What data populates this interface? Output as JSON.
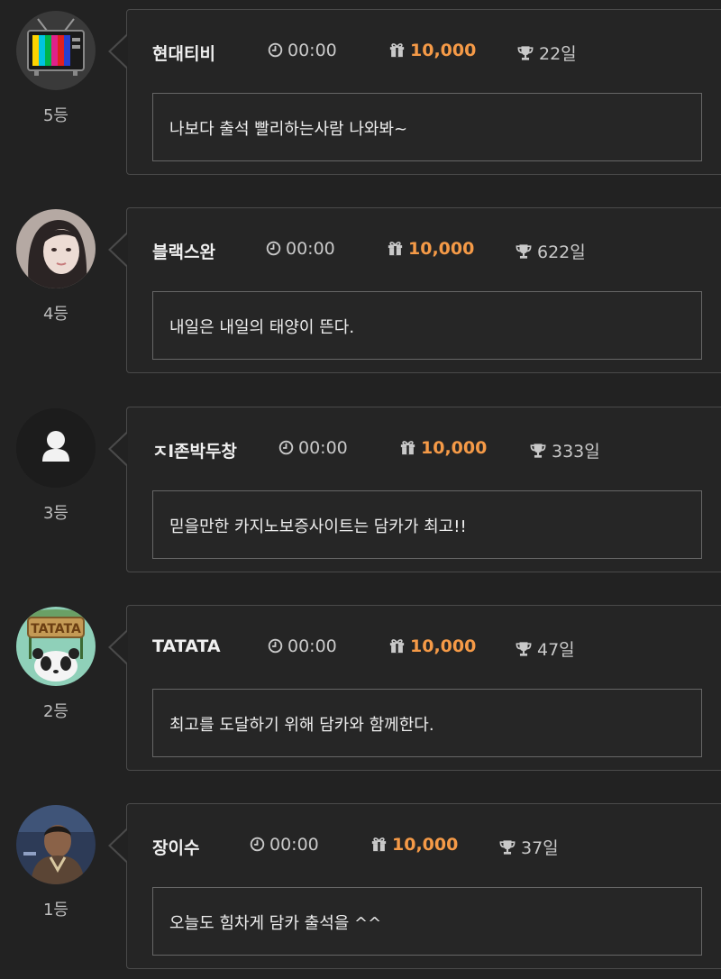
{
  "entries": [
    {
      "rank": "5등",
      "username": "현대티비",
      "time": "00:00",
      "points": "10,000",
      "days": "22일",
      "message": "나보다 출석 빨리하는사람 나와봐~",
      "avatar": "tv-avatar"
    },
    {
      "rank": "4등",
      "username": "블랙스완",
      "time": "00:00",
      "points": "10,000",
      "days": "622일",
      "message": "내일은 내일의 태양이 뜬다.",
      "avatar": "photo-avatar"
    },
    {
      "rank": "3등",
      "username": "ㅈl존박두창",
      "time": "00:00",
      "points": "10,000",
      "days": "333일",
      "message": "믿을만한 카지노보증사이트는 담카가 최고!!",
      "avatar": "default-user-avatar"
    },
    {
      "rank": "2등",
      "username": "TATATA",
      "time": "00:00",
      "points": "10,000",
      "days": "47일",
      "message": "최고를 도달하기 위해 담카와 함께한다.",
      "avatar": "panda-avatar",
      "avatar_text": "TATATA"
    },
    {
      "rank": "1등",
      "username": "장이수",
      "time": "00:00",
      "points": "10,000",
      "days": "37일",
      "message": "오늘도 힘차게 담카 출석을 ^^",
      "avatar": "photo-avatar"
    }
  ],
  "colors": {
    "background": "#222222",
    "border": "#4a4a4a",
    "points": "#f59a47",
    "text": "#eeeeee"
  },
  "icons": {
    "time": "clock-icon",
    "points": "gift-icon",
    "days": "trophy-icon"
  }
}
